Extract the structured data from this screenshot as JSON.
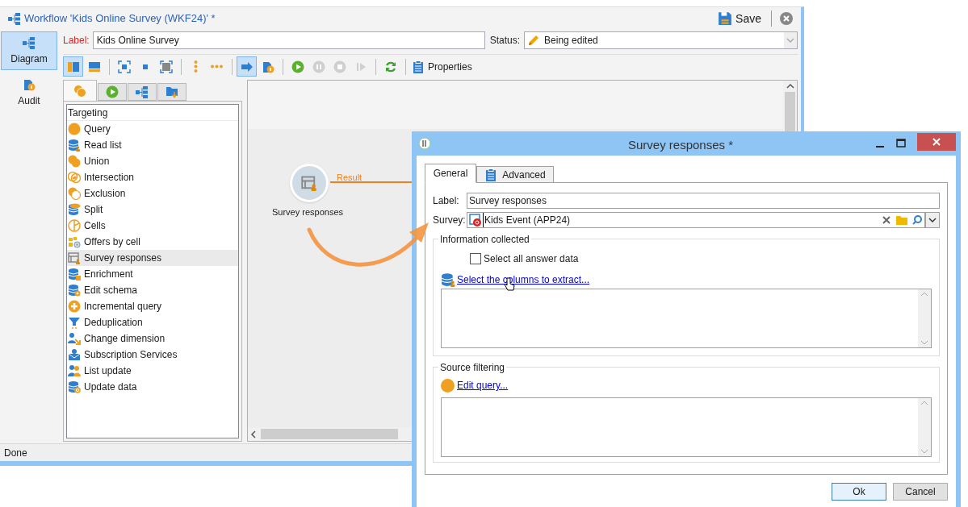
{
  "window": {
    "title": "Workflow 'Kids Online Survey (WKF24)' *",
    "save": "Save"
  },
  "nav": [
    {
      "label": "Diagram",
      "kind": "diagram",
      "selected": true
    },
    {
      "label": "Audit",
      "kind": "audit",
      "selected": false
    }
  ],
  "header": {
    "label_caption": "Label:",
    "label_value": "Kids Online Survey",
    "status_caption": "Status:",
    "status_value": "Being edited"
  },
  "toolbar": {
    "groups": [
      [
        {
          "kind": "split-vertical",
          "selected": true,
          "disabled": false
        },
        {
          "kind": "split-horizontal",
          "selected": false,
          "disabled": false
        }
      ],
      [
        {
          "kind": "fit",
          "selected": false,
          "disabled": false
        },
        {
          "kind": "normal",
          "selected": false,
          "disabled": false
        },
        {
          "kind": "zoom-fit",
          "selected": false,
          "disabled": false
        }
      ],
      [
        {
          "kind": "dots-vertical",
          "selected": false,
          "disabled": false
        },
        {
          "kind": "dots-horizontal",
          "selected": false,
          "disabled": false
        }
      ],
      [
        {
          "kind": "arrow",
          "selected": true,
          "disabled": false
        },
        {
          "kind": "audit",
          "selected": false,
          "disabled": false
        }
      ],
      [
        {
          "kind": "play",
          "selected": false,
          "disabled": false
        },
        {
          "kind": "pause",
          "selected": false,
          "disabled": true
        },
        {
          "kind": "stop",
          "selected": false,
          "disabled": true
        },
        {
          "kind": "step",
          "selected": false,
          "disabled": true
        }
      ],
      [
        {
          "kind": "refresh",
          "selected": false,
          "disabled": false
        }
      ]
    ],
    "properties": "Properties"
  },
  "palette": {
    "tabs": [
      {
        "kind": "targeting",
        "selected": true
      },
      {
        "kind": "flow",
        "selected": false
      },
      {
        "kind": "actions",
        "selected": false
      },
      {
        "kind": "events",
        "selected": false
      }
    ],
    "category": "Targeting",
    "items": [
      {
        "label": "Query",
        "kind": "query",
        "selected": false
      },
      {
        "label": "Read list",
        "kind": "read-list",
        "selected": false
      },
      {
        "label": "Union",
        "kind": "union",
        "selected": false
      },
      {
        "label": "Intersection",
        "kind": "intersection",
        "selected": false
      },
      {
        "label": "Exclusion",
        "kind": "exclusion",
        "selected": false
      },
      {
        "label": "Split",
        "kind": "split",
        "selected": false
      },
      {
        "label": "Cells",
        "kind": "cells",
        "selected": false
      },
      {
        "label": "Offers by cell",
        "kind": "offers",
        "selected": false
      },
      {
        "label": "Survey responses",
        "kind": "survey",
        "selected": true
      },
      {
        "label": "Enrichment",
        "kind": "enrichment",
        "selected": false
      },
      {
        "label": "Edit schema",
        "kind": "edit-schema",
        "selected": false
      },
      {
        "label": "Incremental query",
        "kind": "incremental",
        "selected": false
      },
      {
        "label": "Deduplication",
        "kind": "dedup",
        "selected": false
      },
      {
        "label": "Change dimension",
        "kind": "change-dim",
        "selected": false
      },
      {
        "label": "Subscription Services",
        "kind": "subscription",
        "selected": false
      },
      {
        "label": "List update",
        "kind": "list-update",
        "selected": false
      },
      {
        "label": "Update data",
        "kind": "update-data",
        "selected": false
      }
    ]
  },
  "canvas": {
    "node": {
      "label": "Survey responses",
      "transition": "Result"
    }
  },
  "status_bar": "Done",
  "dialog": {
    "title": "Survey responses *",
    "tabs": [
      {
        "label": "General",
        "selected": true
      },
      {
        "label": "Advanced",
        "selected": false
      }
    ],
    "label_caption": "Label:",
    "label_value": "Survey responses",
    "survey_caption": "Survey:",
    "survey_value": "Kids Event (APP24)",
    "info_group": "Information collected",
    "checkbox": {
      "label": "Select all answer data",
      "checked": false
    },
    "columns_link": "Select the columns to extract...",
    "filter_group": "Source filtering",
    "query_link": "Edit query...",
    "buttons": [
      {
        "label": "Ok",
        "kind": "primary"
      },
      {
        "label": "Cancel",
        "kind": "secondary"
      }
    ]
  }
}
